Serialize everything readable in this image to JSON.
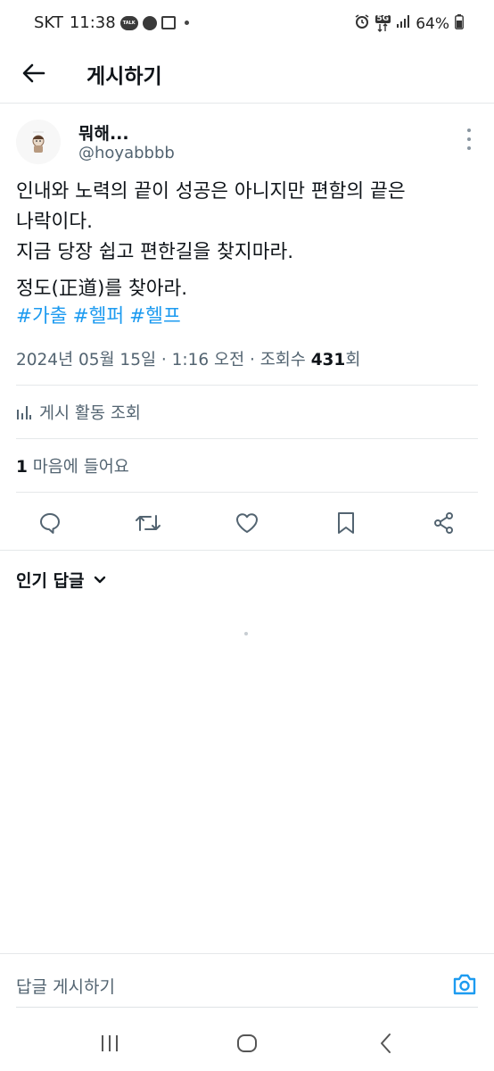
{
  "status_bar": {
    "carrier": "SKT",
    "time": "11:38",
    "network": "5G",
    "battery": "64%",
    "talk_badge": "TALK"
  },
  "header": {
    "title": "게시하기"
  },
  "tweet": {
    "author": {
      "display_name": "뭐해...",
      "handle": "@hoyabbbb"
    },
    "text_lines": [
      "인내와 노력의 끝이 성공은 아니지만 편함의 끝은",
      "나락이다.",
      "지금 당장 쉽고 편한길을 찾지마라.",
      "정도(正道)를 찾아라."
    ],
    "hashtags": [
      "#가출",
      "#헬퍼",
      "#헬프"
    ],
    "meta": {
      "date": "2024년 05월 15일 · 1:16 오전 · 조회수 ",
      "views": "431",
      "views_suffix": "회"
    },
    "activity_label": "게시 활동 조회",
    "likes": {
      "count": "1",
      "label": " 마음에 들어요"
    }
  },
  "replies": {
    "sort_label": "인기 답글"
  },
  "reply_bar": {
    "placeholder": "답글 게시하기"
  },
  "colors": {
    "accent": "#1d9bf0",
    "text": "#0f1419",
    "secondary": "#536471",
    "divider": "#e5e8ea"
  },
  "icons": [
    "back-arrow-icon",
    "more-vertical-icon",
    "chart-icon",
    "reply-icon",
    "retweet-icon",
    "heart-icon",
    "bookmark-icon",
    "share-icon",
    "chevron-down-icon",
    "camera-icon",
    "recent-apps-icon",
    "home-icon",
    "back-nav-icon"
  ]
}
